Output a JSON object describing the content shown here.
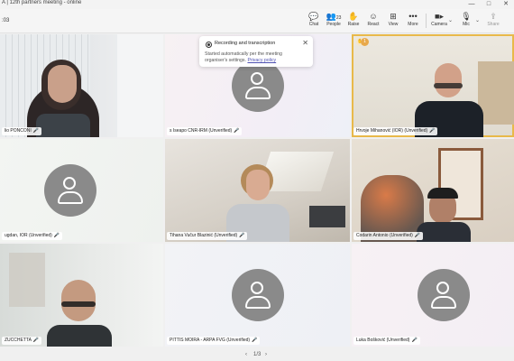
{
  "window": {
    "title": "A | 12th partners meeting - online",
    "minimize": "—",
    "maximize": "□",
    "close": "✕"
  },
  "meeting": {
    "timer": ":03"
  },
  "toolbar": {
    "chat": "Chat",
    "people": "People",
    "people_count": "23",
    "raise": "Raise",
    "react": "React",
    "view": "View",
    "more": "More",
    "camera": "Camera",
    "mic": "Mic",
    "share": "Share"
  },
  "toast": {
    "title": "Recording and transcription",
    "body": "Started automatically per the meeting organiser's settings.",
    "link": "Privacy policy",
    "close": "✕"
  },
  "participants": [
    {
      "name": "lio PONCONI",
      "mic": "🎤"
    },
    {
      "name": "s Iseapo CNR-IRM (Unverified)",
      "mic": "🎤"
    },
    {
      "name": "Hrvoje Mihanović (IOR) (Unverified)",
      "mic": "🎤",
      "badge": "1"
    },
    {
      "name": "ugdan, IOR (Unverified)",
      "mic": "🎤"
    },
    {
      "name": "Tihana Vučur Blazinić (Unverified)",
      "mic": "🎤"
    },
    {
      "name": "Codarin Antonio (Unverified)",
      "mic": "🎤"
    },
    {
      "name": "ZUCCHETTA",
      "mic": "🎤"
    },
    {
      "name": "PITTIS MOIRA - ARPA FVG (Unverified)",
      "mic": "🎤"
    },
    {
      "name": "Luka Bošković (Unverified)",
      "mic": "🎤"
    }
  ],
  "pager": {
    "prev": "‹",
    "label": "1/3",
    "next": "›"
  },
  "colors": {
    "accent": "#4f52b2",
    "active_speaker": "#e8b94a",
    "avatar": "#8a8a8a"
  }
}
